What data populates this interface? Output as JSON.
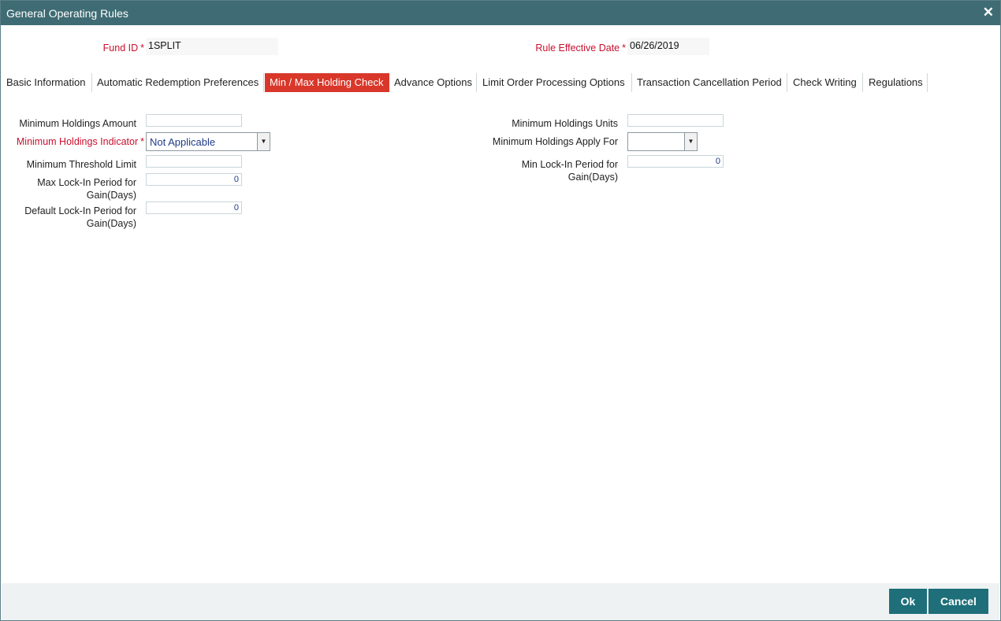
{
  "window": {
    "title": "General Operating Rules"
  },
  "header": {
    "fund_id_label": "Fund ID",
    "fund_id_value": "1SPLIT",
    "rule_effective_date_label": "Rule Effective Date",
    "rule_effective_date_value": "06/26/2019"
  },
  "tabs": [
    {
      "label": "Basic Information"
    },
    {
      "label": "Automatic Redemption Preferences"
    },
    {
      "label": "Min / Max Holding Check"
    },
    {
      "label": "Advance Options"
    },
    {
      "label": "Limit Order Processing Options"
    },
    {
      "label": "Transaction Cancellation Period"
    },
    {
      "label": "Check Writing"
    },
    {
      "label": "Regulations"
    }
  ],
  "active_tab": "Min / Max Holding Check",
  "form": {
    "min_holdings_amount": {
      "label": "Minimum Holdings Amount",
      "value": ""
    },
    "min_holdings_indicator": {
      "label": "Minimum Holdings Indicator",
      "value": "Not Applicable"
    },
    "min_threshold_limit": {
      "label": "Minimum Threshold Limit",
      "value": ""
    },
    "max_lockin_period": {
      "label_line1": "Max Lock-In Period for",
      "label_line2": "Gain(Days)",
      "value": "0"
    },
    "default_lockin_period": {
      "label_line1": "Default Lock-In Period for",
      "label_line2": "Gain(Days)",
      "value": "0"
    },
    "min_holdings_units": {
      "label": "Minimum Holdings Units",
      "value": ""
    },
    "min_holdings_apply_for": {
      "label": "Minimum Holdings Apply For",
      "value": ""
    },
    "min_lockin_period": {
      "label_line1": "Min Lock-In Period for",
      "label_line2": "Gain(Days)",
      "value": "0"
    }
  },
  "buttons": {
    "ok": "Ok",
    "cancel": "Cancel"
  },
  "colors": {
    "titlebar": "#3f6c74",
    "active_tab": "#d8372a",
    "required": "#c8102e",
    "button": "#1e6f7a"
  }
}
